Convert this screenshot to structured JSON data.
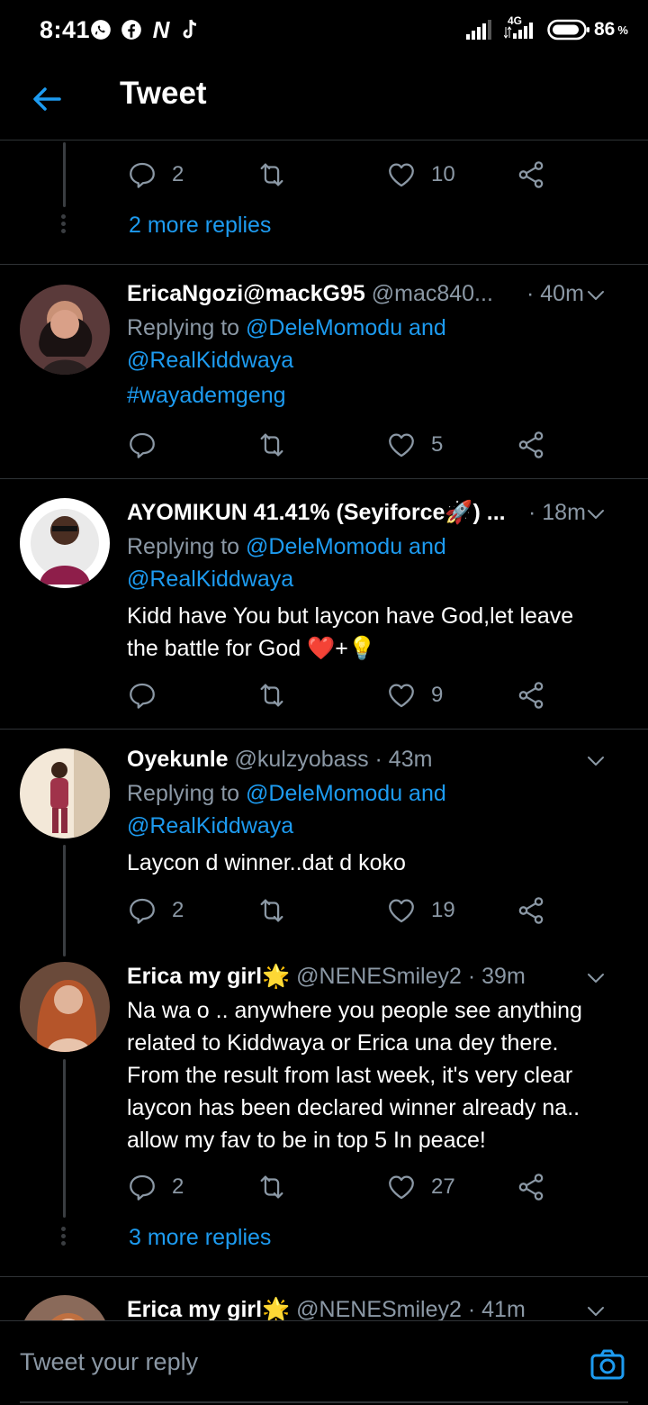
{
  "status_bar": {
    "time": "8:41",
    "network": "4G",
    "battery": "86",
    "battery_unit": "%",
    "notification_icons": [
      "whatsapp-icon",
      "facebook-icon",
      "nairaland-icon",
      "tiktok-icon"
    ]
  },
  "header": {
    "title": "Tweet"
  },
  "colors": {
    "accent": "#1d9bf0",
    "muted": "#8b98a5",
    "divider": "#2f3336",
    "background": "#000000"
  },
  "top_partial": {
    "replies": "2",
    "likes": "10",
    "more_replies": "2 more replies"
  },
  "tweets": [
    {
      "name": "EricaNgozi@mackG95",
      "handle": "@mac840...",
      "time": "· 40m",
      "replying_prefix": "Replying to ",
      "replying_mentions_1": "@DeleMomodu and",
      "replying_mentions_2": "@RealKiddwaya",
      "hashtag": "#wayademgeng",
      "replies": "",
      "likes": "5"
    },
    {
      "name": "AYOMIKUN 41.41% (Seyiforce🚀) ...",
      "handle": "",
      "time": "· 18m",
      "replying_prefix": "Replying to ",
      "replying_mentions_1": "@DeleMomodu and",
      "replying_mentions_2": "@RealKiddwaya",
      "text_line_1": "Kidd have You but laycon have God,let leave",
      "text_line_2": "the battle for God ❤️+💡",
      "replies": "",
      "likes": "9"
    },
    {
      "name": "Oyekunle",
      "handle": "@kulzyobass",
      "time": "· 43m",
      "replying_prefix": "Replying to ",
      "replying_mentions_1": "@DeleMomodu and",
      "replying_mentions_2": "@RealKiddwaya",
      "text_line_1": "Laycon d winner..dat d koko",
      "replies": "2",
      "likes": "19"
    },
    {
      "name": "Erica my girl🌟",
      "handle": "@NENESmiley2",
      "time": "· 39m",
      "text_lines": [
        "Na wa o .. anywhere you people see anything",
        "related to Kiddwaya or Erica una dey there.",
        "From the result from last week, it's very clear",
        "laycon has been declared winner already na..",
        "allow my fav to be in top 5 In peace!"
      ],
      "replies": "2",
      "likes": "27",
      "more_replies": "3 more replies"
    },
    {
      "name": "Erica my girl🌟",
      "handle": "@NENESmiley2",
      "time": "· 41m"
    }
  ],
  "reply_bar": {
    "placeholder": "Tweet your reply"
  }
}
